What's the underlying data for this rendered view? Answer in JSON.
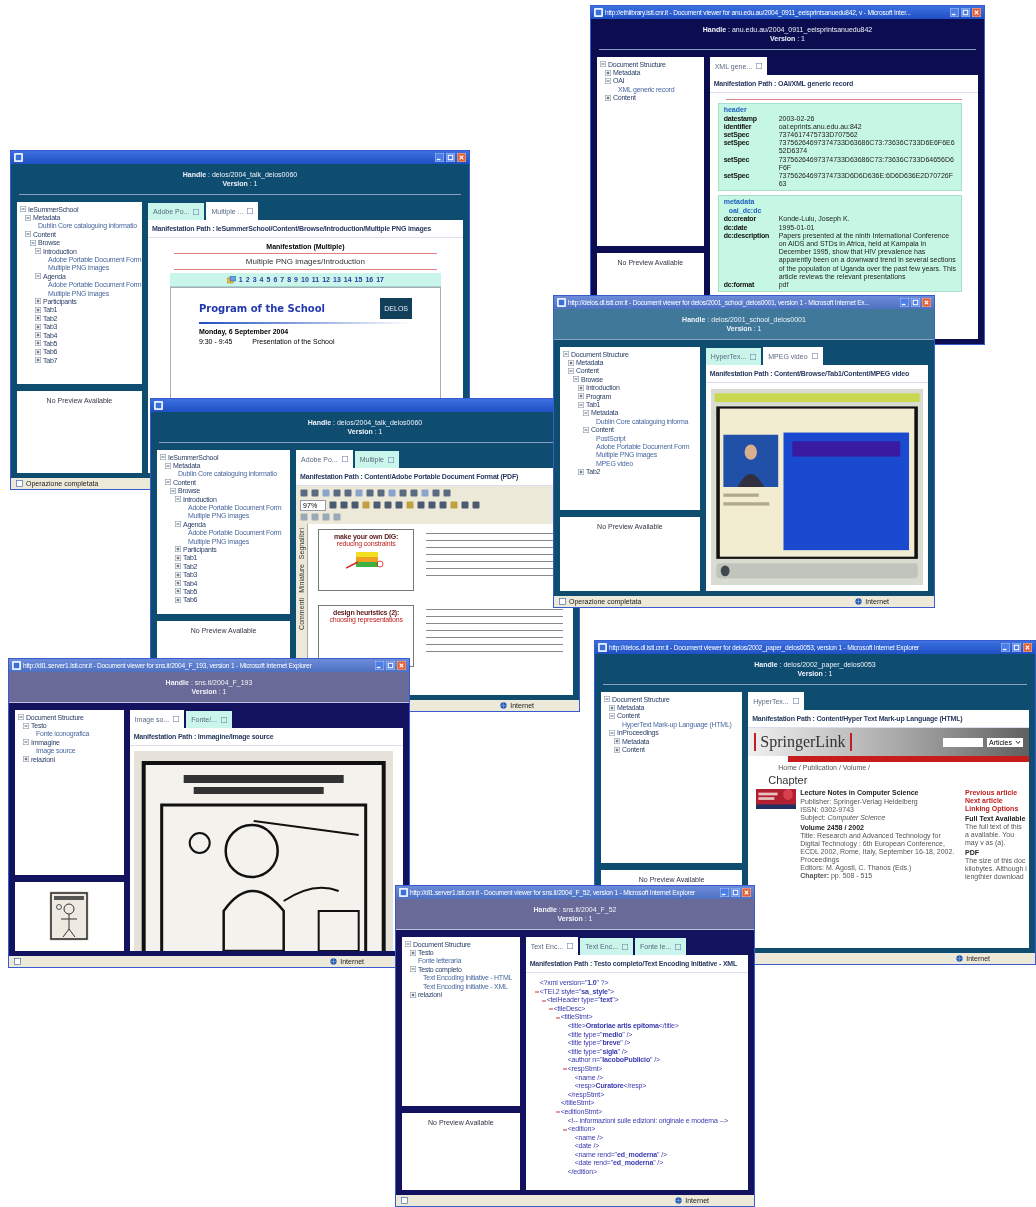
{
  "windows": [
    {
      "kind": "metadata",
      "title": "http://ethlibrary.isti.cnr.it - Document viewer for anu.edu.au/2004_0911_eeisprintsanuedu842, v - Microsoft Inter...",
      "handle_line": "**Handle** : anu.edu.au/2004_0911_eeisprintsanuedu842",
      "version_line": "**Version** : 1",
      "tree": [
        {
          "label": "Document Structure",
          "expanded": true,
          "children": [
            {
              "label": "Metadata",
              "expanded": false
            },
            {
              "label": "OAI",
              "expanded": true,
              "children": [
                {
                  "label": "XML generic record"
                }
              ]
            },
            {
              "label": "Content",
              "expanded": false
            }
          ]
        }
      ],
      "preview": "No Preview Available",
      "tabs": [
        {
          "label": "XML gene...",
          "selected": true
        }
      ],
      "path": "Manifestation Path : OAI/XML generic record",
      "sections": [
        {
          "label": "header",
          "rows": [
            {
              "key": "datestamp",
              "value": "2003-02-26"
            },
            {
              "key": "identifier",
              "value": "oai:eprints.anu.edu.au:842"
            },
            {
              "key": "setSpec",
              "value": "7374617475733D707562"
            },
            {
              "key": "setSpec",
              "value": "73756264697374733D63686C73:73636C733D6E6F6E652D6374"
            },
            {
              "key": "setSpec",
              "value": "73756264697374733D63686C73:73636C733D64656D6F6F"
            },
            {
              "key": "setSpec",
              "value": "73756264697374733D6D6D636E:6D6D636E2D70726F63"
            }
          ]
        },
        {
          "label": "metadata",
          "sub": "oai_dc:dc",
          "rows": [
            {
              "key": "dc:creator",
              "value": "Konde-Lulu, Joseph K."
            },
            {
              "key": "dc:date",
              "value": "1995-01-01"
            },
            {
              "key": "dc:description",
              "value": "Papers presented at the ninth International Conference on AIDS and STDs in Africa, held at Kampala in December 1995, show that HIV prevalence has apparently been on a downward trend in several sections of the population of Uganda over the past few years. This article reviews the relevant presentations"
            },
            {
              "key": "dc:format",
              "value": "pdf"
            }
          ]
        }
      ]
    },
    {
      "kind": "program",
      "handle_line": "**Handle** : delos/2004_talk_delos0060",
      "version_line": "**Version** : 1",
      "tree": [
        {
          "label": "IeSummerSchool",
          "expanded": true,
          "children": [
            {
              "label": "Metadata",
              "expanded": true,
              "children": [
                {
                  "label": "Dublin Core cataloguing informatio"
                }
              ]
            },
            {
              "label": "Content",
              "expanded": true,
              "children": [
                {
                  "label": "Browse",
                  "expanded": true,
                  "children": [
                    {
                      "label": "Introduction",
                      "expanded": true,
                      "children": [
                        {
                          "label": "Adobe Portable Document Form"
                        },
                        {
                          "label": "Multiple PNG images"
                        }
                      ]
                    },
                    {
                      "label": "Agenda",
                      "expanded": true,
                      "children": [
                        {
                          "label": "Adobe Portable Document Form"
                        },
                        {
                          "label": "Multiple PNG images"
                        }
                      ]
                    },
                    {
                      "label": "Participants",
                      "expanded": false
                    },
                    {
                      "label": "Tab1",
                      "expanded": false
                    },
                    {
                      "label": "Tab2",
                      "expanded": false
                    },
                    {
                      "label": "Tab3",
                      "expanded": false
                    },
                    {
                      "label": "Tab4",
                      "expanded": false
                    },
                    {
                      "label": "Tab5",
                      "expanded": false
                    },
                    {
                      "label": "Tab6",
                      "expanded": false
                    },
                    {
                      "label": "Tab7",
                      "expanded": false
                    }
                  ]
                }
              ]
            }
          ]
        }
      ],
      "preview": "No Preview Available",
      "tabs": [
        {
          "label": "Adobe Po...",
          "selected": false
        },
        {
          "label": "Multiple ...",
          "selected": true
        }
      ],
      "path": "Manifestation Path : IeSummerSchool/Content/Browse/Introduction/Multiple PNG images",
      "heading": "Manifestation (Multiple)",
      "subtitle": "Multiple PNG images/Introduction",
      "pages": [
        "1",
        "2",
        "3",
        "4",
        "5",
        "6",
        "7",
        "8",
        "9",
        "10",
        "11",
        "12",
        "13",
        "14",
        "15",
        "16",
        "17"
      ],
      "slide": {
        "title": "Program of the School",
        "logo": "DELOS",
        "date": "Monday, 6 September 2004",
        "rows": [
          {
            "time": "9:30 - 9:45",
            "text": "Presentation of the School"
          }
        ]
      },
      "status": {
        "text": "Operazione completata"
      }
    },
    {
      "kind": "pdf",
      "handle_line": "**Handle** : delos/2004_talk_delos0060",
      "version_line": "**Version** : 1",
      "tree": [
        {
          "label": "IeSummerSchool",
          "expanded": true,
          "children": [
            {
              "label": "Metadata",
              "expanded": true,
              "children": [
                {
                  "label": "Dublin Core cataloguing informatio"
                }
              ]
            },
            {
              "label": "Content",
              "expanded": true,
              "children": [
                {
                  "label": "Browse",
                  "expanded": true,
                  "children": [
                    {
                      "label": "Introduction",
                      "expanded": true,
                      "children": [
                        {
                          "label": "Adobe Portable Document Form"
                        },
                        {
                          "label": "Multiple PNG images"
                        }
                      ]
                    },
                    {
                      "label": "Agenda",
                      "expanded": true,
                      "children": [
                        {
                          "label": "Adobe Portable Document Form"
                        },
                        {
                          "label": "Multiple PNG images"
                        }
                      ]
                    },
                    {
                      "label": "Participants",
                      "expanded": false
                    },
                    {
                      "label": "Tab1",
                      "expanded": false
                    },
                    {
                      "label": "Tab2",
                      "expanded": false
                    },
                    {
                      "label": "Tab3",
                      "expanded": false
                    },
                    {
                      "label": "Tab4",
                      "expanded": false
                    },
                    {
                      "label": "Tab5",
                      "expanded": false
                    },
                    {
                      "label": "Tab6",
                      "expanded": false
                    }
                  ]
                }
              ]
            }
          ]
        }
      ],
      "preview": "No Preview Available",
      "tabs": [
        {
          "label": "Adobe Po...",
          "selected": true
        },
        {
          "label": "Multiple",
          "selected": false
        }
      ],
      "path": "Manifestation Path : Content/Adobe Portable Document Format (PDF)",
      "zoom": "97%",
      "side_tabs": [
        "Segnalibri",
        "Miniature",
        "Commenti"
      ],
      "slides": [
        {
          "title": "make your own DIG:",
          "subtitle": "reducing constraints"
        },
        {
          "title": "design heuristics (2):",
          "subtitle": "choosing representations"
        }
      ],
      "status": {
        "zone": "Internet"
      }
    },
    {
      "kind": "video",
      "title": "http://delos.dl.isti.cnr.it - Document viewer for delos/2001_school_delos0001, version 1 - Microsoft Internet Ex...",
      "handle_line": "**Handle** : delos/2001_school_delos0001",
      "version_line": "**Version** : 1",
      "tree": [
        {
          "label": "Document Structure",
          "expanded": true,
          "children": [
            {
              "label": "Metadata",
              "expanded": false
            },
            {
              "label": "Content",
              "expanded": true,
              "children": [
                {
                  "label": "Browse",
                  "expanded": true,
                  "children": [
                    {
                      "label": "Introduction",
                      "expanded": false
                    },
                    {
                      "label": "Program",
                      "expanded": false
                    },
                    {
                      "label": "Tab1",
                      "expanded": true,
                      "children": [
                        {
                          "label": "Metadata",
                          "expanded": true,
                          "children": [
                            {
                              "label": "Dublin Core cataloguing informa"
                            }
                          ]
                        },
                        {
                          "label": "Content",
                          "expanded": true,
                          "children": [
                            {
                              "label": "PostScript"
                            },
                            {
                              "label": "Adobe Portable Document Form"
                            },
                            {
                              "label": "Multiple PNG images"
                            },
                            {
                              "label": "MPEG video"
                            }
                          ]
                        }
                      ]
                    },
                    {
                      "label": "Tab2",
                      "expanded": false
                    }
                  ]
                }
              ]
            }
          ]
        }
      ],
      "preview": "No Preview Available",
      "tabs": [
        {
          "label": "HyperTex...",
          "selected": false
        },
        {
          "label": "MPEG video",
          "selected": true
        }
      ],
      "path": "Manifestation Path : Content/Browse/Tab1/Content/MPEG video",
      "status": {
        "text": "Operazione completata",
        "zone": "Internet"
      }
    },
    {
      "title": "http://dl1.server1.isti.cnr.it - Document viewer for sns.it/2004_F_193, version 1 - Microsoft Internet Explorer",
      "handle_line": "**Handle** : sns.it/2004_F_193",
      "version_line": "**Version** : 1",
      "tree": [
        {
          "label": "Document Structure",
          "expanded": true,
          "children": [
            {
              "label": "Testo",
              "expanded": true,
              "children": [
                {
                  "label": "Fonte iconografica"
                }
              ]
            },
            {
              "label": "Immagine",
              "expanded": true,
              "children": [
                {
                  "label": "Image source"
                }
              ]
            },
            {
              "label": "relazioni",
              "expanded": false
            }
          ]
        }
      ],
      "tabs": [
        {
          "label": "Image so...",
          "selected": true
        },
        {
          "label": "Fonte/...",
          "selected": false
        }
      ],
      "path": "Manifestation Path : Immagine/Image source",
      "status": {
        "zone": "Internet"
      }
    },
    {
      "kind": "springer",
      "title": "http://delos.dl.isti.cnr.it - Document viewer for delos/2002_paper_delos0053, version 1 - Microsoft Internet Explorer",
      "handle_line": "**Handle** : delos/2002_paper_delos0053",
      "version_line": "**Version** : 1",
      "tree": [
        {
          "label": "Document Structure",
          "expanded": true,
          "children": [
            {
              "label": "Metadata",
              "expanded": false
            },
            {
              "label": "Content",
              "expanded": true,
              "children": [
                {
                  "label": "HyperText Mark-up Language (HTML)"
                }
              ]
            },
            {
              "label": "InProceedings",
              "expanded": true,
              "children": [
                {
                  "label": "Metadata",
                  "expanded": false
                },
                {
                  "label": "Content",
                  "expanded": false
                }
              ]
            }
          ]
        }
      ],
      "preview": "No Preview Available",
      "tabs": [
        {
          "label": "HyperTex...",
          "selected": true
        }
      ],
      "path": "Manifestation Path : Content/Hyper Text Mark-up Language (HTML)",
      "site": {
        "logo": "SpringerLink",
        "select": "Articles",
        "breadcrumb": "Home / Publication / Volume /",
        "heading": "Chapter",
        "series": "Lecture Notes in Computer Science",
        "details": [
          "Publisher: Springer-Verlag Heidelberg",
          "ISSN: 0302-9743",
          "Subject: *Computer Science*"
        ],
        "volume": "Volume 2458 / 2002",
        "info": [
          "Title: Research and Advanced Technology for Digital Technology : 6th European Conference, ECDL 2002, Rome, Italy, September 16-18, 2002. Proceedings",
          "Editors: M. Agosti, C. Thanos (Eds.)",
          "**Chapter:** pp. 508 - 515"
        ],
        "side": [
          {
            "kind": "link",
            "text": "Previous article"
          },
          {
            "kind": "link",
            "text": "Next article"
          },
          {
            "kind": "link",
            "text": "Linking Options"
          },
          {
            "kind": "head",
            "text": "Full Text Available"
          },
          {
            "kind": "text",
            "text": "The full text of this a available. You may v as (a)."
          },
          {
            "kind": "head",
            "text": "PDF"
          },
          {
            "kind": "text",
            "text": "The size of this doc kilobytes. Although i lengthier download"
          }
        ]
      },
      "status": {
        "zone": "Internet"
      }
    },
    {
      "kind": "xml",
      "title": "http://dl1.server1.isti.cnr.it - Document viewer for sns.it/2004_F_52, version 1 - Microsoft Internet Explorer",
      "handle_line": "**Handle** : sns.it/2004_F_52",
      "version_line": "**Version** : 1",
      "tree": [
        {
          "label": "Document Structure",
          "expanded": true,
          "children": [
            {
              "label": "Testo",
              "expanded": false
            },
            {
              "label": "Fonte letteraria"
            },
            {
              "label": "Testo completo",
              "expanded": true,
              "children": [
                {
                  "label": "Text Encoding Initiative - HTML"
                },
                {
                  "label": "Text Encoding Initiative - XML"
                }
              ]
            },
            {
              "label": "relazioni",
              "expanded": false
            }
          ]
        }
      ],
      "preview": "No Preview Available",
      "tabs": [
        {
          "label": "Text Enc...",
          "selected": true
        },
        {
          "label": "Text Enc...",
          "selected": false
        },
        {
          "label": "Fonte le...",
          "selected": false
        }
      ],
      "path": "Manifestation Path : Testo completo/Text Encoding Initiative - XML",
      "xml": [
        {
          "line": "<?xml version=\"**1.0**\" ?>",
          "toggle": false
        },
        {
          "line": "<TEI.2 style=\"**sa_style**\">",
          "toggle": true,
          "children": [
            {
              "line": "<teiHeader type=\"**text**\">",
              "toggle": true,
              "children": [
                {
                  "line": "<fileDesc>",
                  "toggle": true,
                  "children": [
                    {
                      "line": "<titleStmt>",
                      "toggle": true,
                      "children": [
                        {
                          "line": "<title>**Oratoriae artis epitoma**</title>",
                          "toggle": false
                        },
                        {
                          "line": "<title type=\"**medio**\" />",
                          "toggle": false
                        },
                        {
                          "line": "<title type=\"**breve**\" />",
                          "toggle": false
                        },
                        {
                          "line": "<title type=\"**sigla**\" />",
                          "toggle": false
                        },
                        {
                          "line": "<author n=\"**IacoboPublicio**\" />",
                          "toggle": false
                        },
                        {
                          "line": "<respStmt>",
                          "toggle": true,
                          "children": [
                            {
                              "line": "<name />",
                              "toggle": false
                            },
                            {
                              "line": "<resp>**Curatore**</resp>",
                              "toggle": false
                            }
                          ]
                        },
                        {
                          "line": "</respStmt>",
                          "toggle": false
                        }
                      ]
                    },
                    {
                      "line": "</titleStmt>",
                      "toggle": false
                    },
                    {
                      "line": "<editionStmt>",
                      "toggle": true,
                      "children": [
                        {
                          "line": "<!-- informazioni sulle edizioni: originale e moderna -->",
                          "toggle": false
                        },
                        {
                          "line": "<edition>",
                          "toggle": true,
                          "children": [
                            {
                              "line": "<name />",
                              "toggle": false
                            },
                            {
                              "line": "<date />",
                              "toggle": false
                            },
                            {
                              "line": "<name rend=\"**ed_moderna**\" />",
                              "toggle": false
                            },
                            {
                              "line": "<date rend=\"**ed_moderna**\" />",
                              "toggle": false
                            }
                          ]
                        },
                        {
                          "line": "</edition>",
                          "toggle": false
                        }
                      ]
                    }
                  ]
                }
              ]
            }
          ]
        }
      ],
      "status": {
        "zone": "Internet"
      }
    }
  ]
}
